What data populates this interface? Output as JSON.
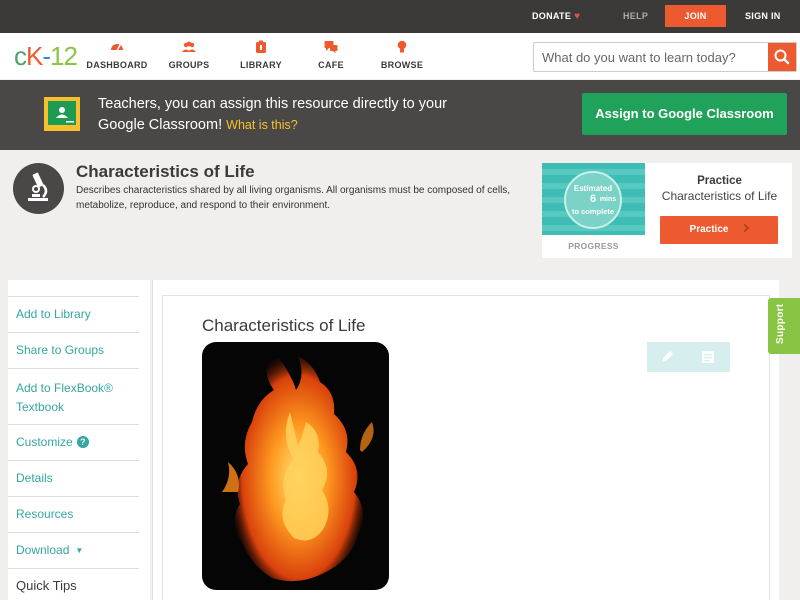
{
  "topbar": {
    "donate": "DONATE",
    "help": "HELP",
    "join": "JOIN",
    "signin": "SIGN IN"
  },
  "logo": {
    "c": "c",
    "k": "K",
    "dash": "-",
    "num": "12"
  },
  "nav": {
    "items": [
      {
        "label": "DASHBOARD",
        "icon": "dashboard-icon"
      },
      {
        "label": "GROUPS",
        "icon": "groups-icon"
      },
      {
        "label": "LIBRARY",
        "icon": "library-icon"
      },
      {
        "label": "CAFE",
        "icon": "cafe-icon"
      },
      {
        "label": "BROWSE",
        "icon": "browse-icon"
      }
    ],
    "search_placeholder": "What do you want to learn today?"
  },
  "banner": {
    "text": "Teachers, you can assign this resource directly to your Google Classroom!",
    "link": "What is this?",
    "button": "Assign to Google Classroom"
  },
  "resource": {
    "title": "Characteristics of Life",
    "description": "Describes characteristics shared by all living organisms. All organisms must be composed of cells, metabolize, reproduce, and respond to their environment."
  },
  "practice": {
    "estimated": "Estimated",
    "mins": "6",
    "mins_unit": "mins",
    "to_complete": "to complete",
    "progress": "PROGRESS",
    "title": "Practice",
    "subtitle": "Characteristics of Life",
    "button": "Practice"
  },
  "sidebar": {
    "items": [
      {
        "label": "Add to Library"
      },
      {
        "label": "Share to Groups"
      },
      {
        "label": "Add to FlexBook® Textbook"
      },
      {
        "label": "Customize"
      },
      {
        "label": "Details"
      },
      {
        "label": "Resources"
      },
      {
        "label": "Download"
      }
    ],
    "quick_tips": "Quick Tips"
  },
  "content": {
    "title": "Characteristics of Life"
  },
  "support": "Support",
  "colors": {
    "accent": "#ee5a2f",
    "teal": "#35a6a0",
    "green": "#21a25a",
    "support_green": "#8ac444"
  }
}
